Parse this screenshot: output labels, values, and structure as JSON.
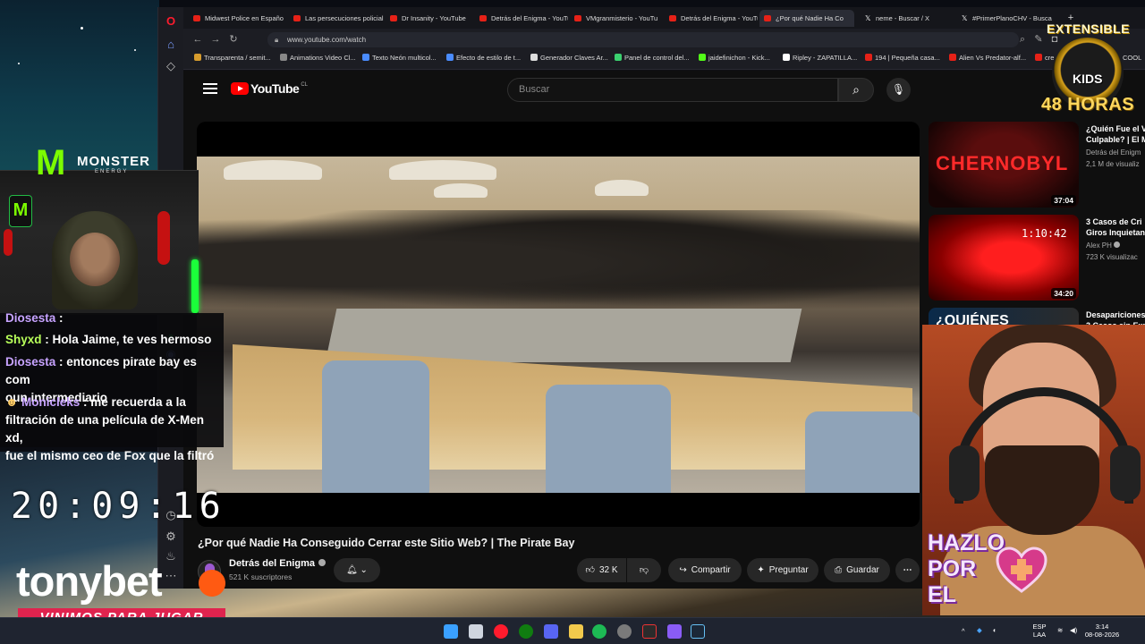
{
  "browser": {
    "tabs": [
      {
        "label": "Midwest Police en Españo",
        "fav": "youtube"
      },
      {
        "label": "Las persecuciones policial",
        "fav": "youtube"
      },
      {
        "label": "Dr Insanity - YouTube",
        "fav": "youtube"
      },
      {
        "label": "Detrás del Enigma - YouTu",
        "fav": "youtube"
      },
      {
        "label": "VMgranmisterio - YouTu",
        "fav": "youtube"
      },
      {
        "label": "Detrás del Enigma - YouTu",
        "fav": "youtube"
      },
      {
        "label": "¿Por qué Nadie Ha Co",
        "fav": "youtube"
      },
      {
        "label": "neme - Buscar / X",
        "fav": "x"
      },
      {
        "label": "#PrimerPlanoCHV - Busca",
        "fav": "x"
      }
    ],
    "url": "www.youtube.com/watch",
    "bookmarks": [
      "Transparenta / semit...",
      "Animations Video Cl...",
      "Texto Neón multicol...",
      "Efecto de estilo de t...",
      "Generador Claves Ar...",
      "Panel de control del...",
      "jaidefinichon - Kick...",
      "Ripley - ZAPATILLA...",
      "194 | Pequeña casa...",
      "Alien Vs Predator-alf...",
      "cre"
    ],
    "bookmark_extra": "COOL"
  },
  "youtube": {
    "logo_text": "YouTube",
    "country": "CL",
    "search_placeholder": "Buscar",
    "video_title": "¿Por qué Nadie Ha Conseguido Cerrar este Sitio Web? | The Pirate Bay",
    "channel_name": "Detrás del Enigma",
    "subscribers": "521 K suscriptores",
    "likes": "32 K",
    "share_label": "Compartir",
    "ask_label": "Preguntar",
    "save_label": "Guardar",
    "recommendations": [
      {
        "title_line1": "¿Quién Fue el V",
        "title_line2": "Culpable? | El M",
        "channel": "Detrás del Enigm",
        "views": "2,1 M de visualiz",
        "duration": "37:04",
        "thumb_text": "CHERNOBYL"
      },
      {
        "title_line1": "3 Casos de Cri",
        "title_line2": "Giros Inquietan",
        "channel": "Alex PH",
        "views": "723 K visualizac",
        "duration": "34:20",
        "thumb_text": "1:10:42"
      },
      {
        "title_line1": "Desapariciones",
        "title_line2": "3 Casos sin Exp",
        "channel": "",
        "views": "",
        "duration": "",
        "thumb_text": "¿QUIÉNES"
      }
    ]
  },
  "stream": {
    "chat": [
      {
        "user": "Diosesta",
        "user_color": "#c7a3ff",
        "message": ""
      },
      {
        "user": "Shyxd",
        "user_color": "#b8ff5a",
        "message": "Hola Jaime, te ves hermoso"
      },
      {
        "user": "Diosesta",
        "user_color": "#c7a3ff",
        "message": "entonces pirate bay es com",
        "message2": "oun intermediario"
      },
      {
        "user": "Monicleks",
        "user_color": "#c7a3ff",
        "message": "me recuerda a la",
        "message2": "filtración de una película de X-Men xd,",
        "message3": "fue el mismo ceo de Fox que la filtró"
      }
    ],
    "clock": "20:09:16",
    "sponsor": "tonybet",
    "sponsor_tagline": "VINIMOS PARA JUGAR",
    "monster_brand": "MONSTER",
    "monster_sub": "ENERGY",
    "extensible_top": "EXTENSIBLE",
    "extensible_kids": "KIDS",
    "extensible_bottom": "48 HORAS",
    "hazlo": [
      "HAZLO",
      "POR",
      "EL"
    ]
  },
  "taskbar": {
    "lang": "ESP",
    "lang2": "LAA",
    "time": "3:14",
    "date": "08-08-2026"
  },
  "colors": {
    "youtube_red": "#ff0000",
    "tonybet_orange": "#ff5a12",
    "vinimos_bg": "#e0234e",
    "monster_green": "#7cfc00"
  }
}
